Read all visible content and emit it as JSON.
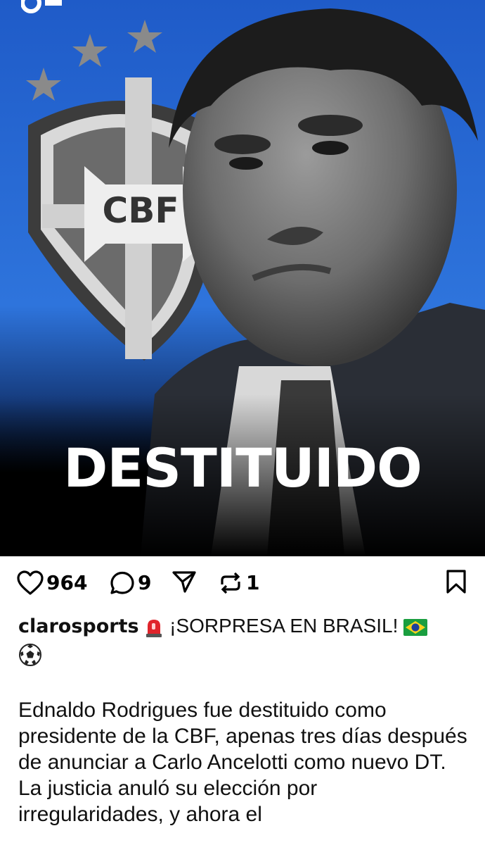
{
  "post": {
    "headline": "DESTITUIDO",
    "crest_text": "CBF"
  },
  "actions": {
    "likes": "964",
    "comments": "9",
    "reposts": "1"
  },
  "caption": {
    "username": "clarosports",
    "headline": "¡SORPRESA EN BRASIL!",
    "body": "Ednaldo Rodrigues fue destituido como presidente de la CBF, apenas tres días después de anunciar a Carlo Ancelotti como nuevo DT. La justicia anuló su elección por irregularidades, y ahora el"
  },
  "colors": {
    "background_blue": "#2f6fd6",
    "text": "#111111",
    "background_black": "#000000"
  }
}
